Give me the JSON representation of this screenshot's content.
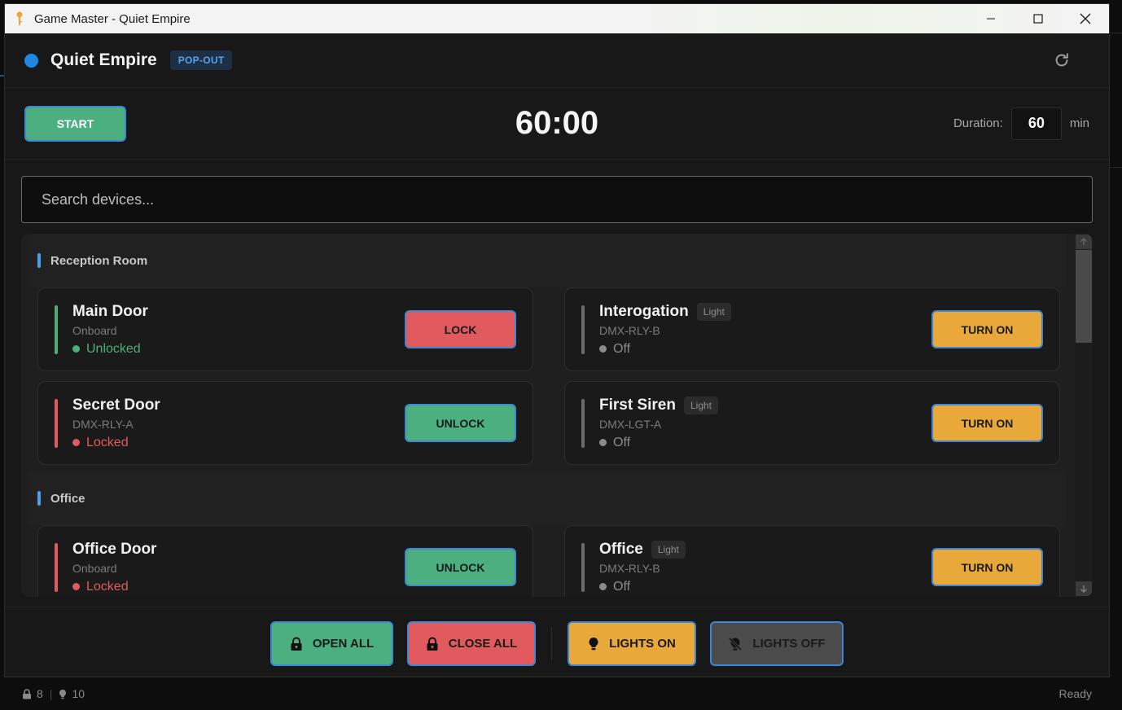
{
  "window": {
    "title": "Game Master - Quiet Empire"
  },
  "header": {
    "room_name": "Quiet Empire",
    "badge": "POP-OUT",
    "status_color": "#1e88e5"
  },
  "timer": {
    "start_label": "START",
    "display": "60:00",
    "duration_label": "Duration:",
    "duration_value": "60",
    "duration_unit": "min"
  },
  "search": {
    "placeholder": "Search devices..."
  },
  "sections": [
    {
      "title": "Reception Room",
      "devices": [
        {
          "name": "Main Door",
          "badge": "",
          "source": "Onboard",
          "status": "Unlocked",
          "action": "LOCK"
        },
        {
          "name": "Interogation",
          "badge": "Light",
          "source": "DMX-RLY-B",
          "status": "Off",
          "action": "TURN ON"
        },
        {
          "name": "Secret Door",
          "badge": "",
          "source": "DMX-RLY-A",
          "status": "Locked",
          "action": "UNLOCK"
        },
        {
          "name": "First Siren",
          "badge": "Light",
          "source": "DMX-LGT-A",
          "status": "Off",
          "action": "TURN ON"
        }
      ]
    },
    {
      "title": "Office",
      "devices": [
        {
          "name": "Office Door",
          "badge": "",
          "source": "Onboard",
          "status": "Locked",
          "action": "UNLOCK"
        },
        {
          "name": "Office",
          "badge": "Light",
          "source": "DMX-RLY-B",
          "status": "Off",
          "action": "TURN ON"
        }
      ]
    }
  ],
  "actions": {
    "open_all": "OPEN ALL",
    "close_all": "CLOSE ALL",
    "lights_on": "LIGHTS ON",
    "lights_off": "LIGHTS OFF"
  },
  "statusbar": {
    "lock_count": "8",
    "light_count": "10",
    "state": "Ready"
  },
  "colors": {
    "green": "#4caf80",
    "red": "#e05a5e",
    "amber": "#e8a93a",
    "accent_blue": "#3e86d6"
  }
}
